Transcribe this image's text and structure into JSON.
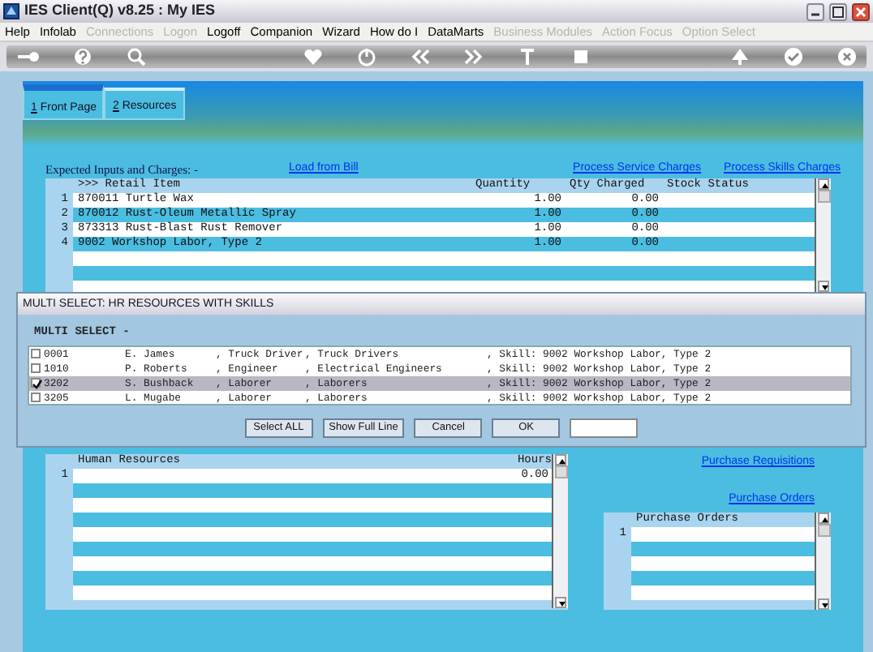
{
  "window": {
    "title": "IES Client(Q) v8.25 : My IES"
  },
  "menu": [
    {
      "label": "Help",
      "disabled": false
    },
    {
      "label": "Infolab",
      "disabled": false
    },
    {
      "label": "Connections",
      "disabled": true
    },
    {
      "label": "Logon",
      "disabled": true
    },
    {
      "label": "Logoff",
      "disabled": false
    },
    {
      "label": "Companion",
      "disabled": false
    },
    {
      "label": "Wizard",
      "disabled": false
    },
    {
      "label": "How do I",
      "disabled": false
    },
    {
      "label": "DataMarts",
      "disabled": false
    },
    {
      "label": "Business Modules",
      "disabled": true
    },
    {
      "label": "Action Focus",
      "disabled": true
    },
    {
      "label": "Option Select",
      "disabled": true
    }
  ],
  "tabs": [
    {
      "key": "1",
      "label": " Front Page",
      "selected": false
    },
    {
      "key": "2",
      "label": " Resources",
      "selected": true
    }
  ],
  "expected": {
    "title": "Expected Inputs and Charges: -",
    "links": [
      "Load from Bill",
      "Process Service Charges",
      "Process Skills Charges"
    ],
    "columns": [
      ">>> Retail Item",
      "Quantity",
      "Qty Charged",
      "Stock Status"
    ],
    "rows": [
      {
        "num": "1",
        "item": "870011 Turtle Wax",
        "quantity": "1.00",
        "qty_charged": "0.00"
      },
      {
        "num": "2",
        "item": "870012 Rust-Oleum Metallic Spray",
        "quantity": "1.00",
        "qty_charged": "0.00"
      },
      {
        "num": "3",
        "item": "873313 Rust-Blast Rust Remover",
        "quantity": "1.00",
        "qty_charged": "0.00"
      },
      {
        "num": "4",
        "item": "9002 Workshop Labor, Type 2",
        "quantity": "1.00",
        "qty_charged": "0.00"
      }
    ]
  },
  "dialog": {
    "title": "MULTI SELECT: HR RESOURCES WITH SKILLS",
    "label": "MULTI SELECT -",
    "rows": [
      {
        "code": "0001",
        "name": "E. James",
        "role": ", Truck Driver",
        "group": ", Truck Drivers",
        "skill": ", Skill: 9002 Workshop Labor, Type 2",
        "checked": false,
        "selected": false
      },
      {
        "code": "1010",
        "name": "P. Roberts",
        "role": ", Engineer",
        "group": ", Electrical Engineers",
        "skill": ", Skill: 9002 Workshop Labor, Type 2",
        "checked": false,
        "selected": false
      },
      {
        "code": "3202",
        "name": "S. Bushback",
        "role": ", Laborer",
        "group": ", Laborers",
        "skill": ", Skill: 9002 Workshop Labor, Type 2",
        "checked": true,
        "selected": true
      },
      {
        "code": "3205",
        "name": "L. Mugabe",
        "role": ", Laborer",
        "group": ", Laborers",
        "skill": ", Skill: 9002 Workshop Labor, Type 2",
        "checked": false,
        "selected": false
      }
    ],
    "buttons": [
      "Select ALL",
      "Show Full Line",
      "Cancel",
      "OK"
    ]
  },
  "human_resources": {
    "columns": [
      "Human Resources",
      "Hours"
    ],
    "rows": [
      {
        "num": "1",
        "hours": "0.00"
      }
    ]
  },
  "purchase_links": [
    "Purchase Requisitions",
    "Purchase Orders"
  ],
  "purchase_orders": {
    "columns": [
      "Purchase Orders"
    ],
    "rows": [
      {
        "num": "1"
      }
    ]
  }
}
